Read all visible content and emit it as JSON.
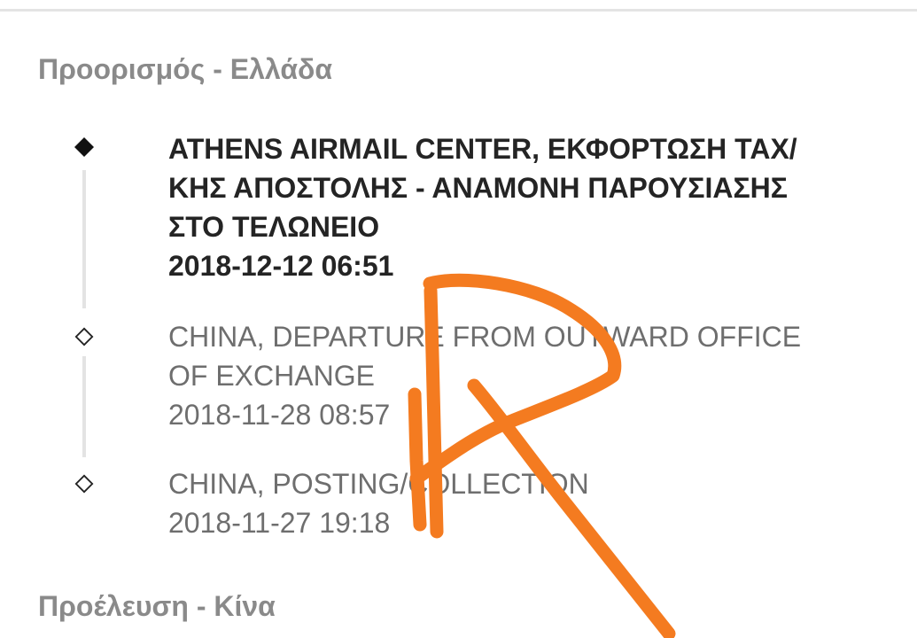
{
  "destination": {
    "header": "Προορισμός - Ελλάδα"
  },
  "events": [
    {
      "lines": [
        "ATHENS AIRMAIL CENTER, ΕΚΦΟΡΤΩΣΗ ΤΑΧ/",
        "ΚΗΣ ΑΠΟΣΤΟΛΗΣ - ΑΝΑΜΟΝΗ ΠΑΡΟΥΣΙΑΣΗΣ",
        "ΣΤΟ ΤΕΛΩΝΕΙΟ"
      ],
      "datetime": "2018-12-12 06:51",
      "marker": "filled-diamond-icon"
    },
    {
      "lines": [
        "CHINA, DEPARTURE FROM OUTWARD OFFICE",
        "OF EXCHANGE"
      ],
      "datetime": "2018-11-28 08:57",
      "marker": "outline-diamond-icon"
    },
    {
      "lines": [
        "CHINA, POSTING/COLLECTION"
      ],
      "datetime": "2018-11-27 19:18",
      "marker": "outline-diamond-icon"
    }
  ],
  "origin": {
    "header": "Προέλευση - Κίνα"
  },
  "colors": {
    "header_text": "#8a8a8a",
    "current_event_text": "#242424",
    "past_event_text": "#6e6e6e",
    "timeline_line": "#e3e3e3",
    "scribble": "#f47b20"
  }
}
